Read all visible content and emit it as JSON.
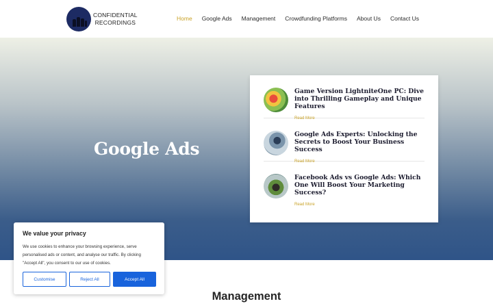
{
  "header": {
    "logo_line1": "CONFIDENTIAL",
    "logo_line2": "RECORDINGS",
    "nav": [
      {
        "label": "Home",
        "active": true
      },
      {
        "label": "Google Ads",
        "active": false
      },
      {
        "label": "Management",
        "active": false
      },
      {
        "label": "Crowdfunding Platforms",
        "active": false
      },
      {
        "label": "About Us",
        "active": false
      },
      {
        "label": "Contact Us",
        "active": false
      }
    ]
  },
  "hero": {
    "title": "Google Ads"
  },
  "posts": [
    {
      "title": "Game Version LightniteOne PC: Dive into Thrilling Gameplay and Unique Features",
      "link": "Read More",
      "thumb": "colorful-game-thumbnail"
    },
    {
      "title": "Google Ads Experts: Unlocking the Secrets to Boost Your Business Success",
      "link": "Read More",
      "thumb": "man-at-laptop-thumbnail"
    },
    {
      "title": "Facebook Ads vs Google Ads: Which One Will Boost Your Marketing Success?",
      "link": "Read More",
      "thumb": "desk-plants-thumbnail"
    }
  ],
  "cookie": {
    "title": "We value your privacy",
    "text": "We use cookies to enhance your browsing experience, serve personalised ads or content, and analyse our traffic. By clicking \"Accept All\", you consent to our use of cookies.",
    "customise": "Customise",
    "reject": "Reject All",
    "accept": "Accept All"
  },
  "section": {
    "title": "Management"
  },
  "colors": {
    "accent": "#c9a227",
    "button_blue": "#1863dc",
    "logo_navy": "#1d2b63"
  }
}
